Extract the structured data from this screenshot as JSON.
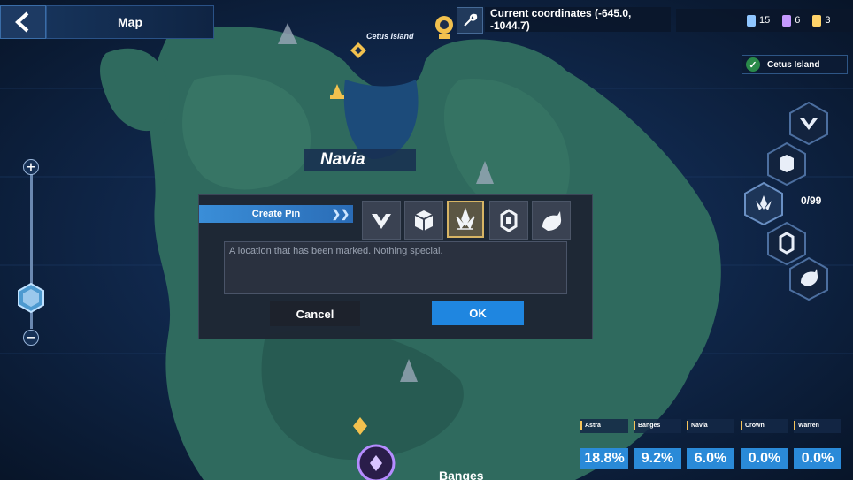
{
  "header": {
    "title": "Map",
    "coordinates": "Current coordinates (-645.0, -1044.7)",
    "counters": [
      {
        "icon": "blue-cube-icon",
        "value": "15",
        "color": "#8fc6ff"
      },
      {
        "icon": "purple-cube-icon",
        "value": "6",
        "color": "#c59aff"
      },
      {
        "icon": "gold-cube-icon",
        "value": "3",
        "color": "#ffd36a"
      }
    ]
  },
  "region": {
    "name": "Cetus Island"
  },
  "map": {
    "island_label": "Cetus Island",
    "area_label": "Navia",
    "bottom_label": "Banges"
  },
  "pin_counter": "0/99",
  "dialog": {
    "title": "Create Pin",
    "description": "A location that has been marked. Nothing special.",
    "cancel_label": "Cancel",
    "ok_label": "OK",
    "pin_options": [
      {
        "icon": "chevron-crown-pin-icon",
        "selected": false
      },
      {
        "icon": "crate-pin-icon",
        "selected": false
      },
      {
        "icon": "lotus-pin-icon",
        "selected": true
      },
      {
        "icon": "crystal-pin-icon",
        "selected": false
      },
      {
        "icon": "creature-pin-icon",
        "selected": false
      }
    ]
  },
  "exploration": [
    {
      "name": "Astra",
      "percent": "18.8%"
    },
    {
      "name": "Banges",
      "percent": "9.2%"
    },
    {
      "name": "Navia",
      "percent": "6.0%"
    },
    {
      "name": "Crown",
      "percent": "0.0%"
    },
    {
      "name": "Warren",
      "percent": "0.0%"
    }
  ]
}
